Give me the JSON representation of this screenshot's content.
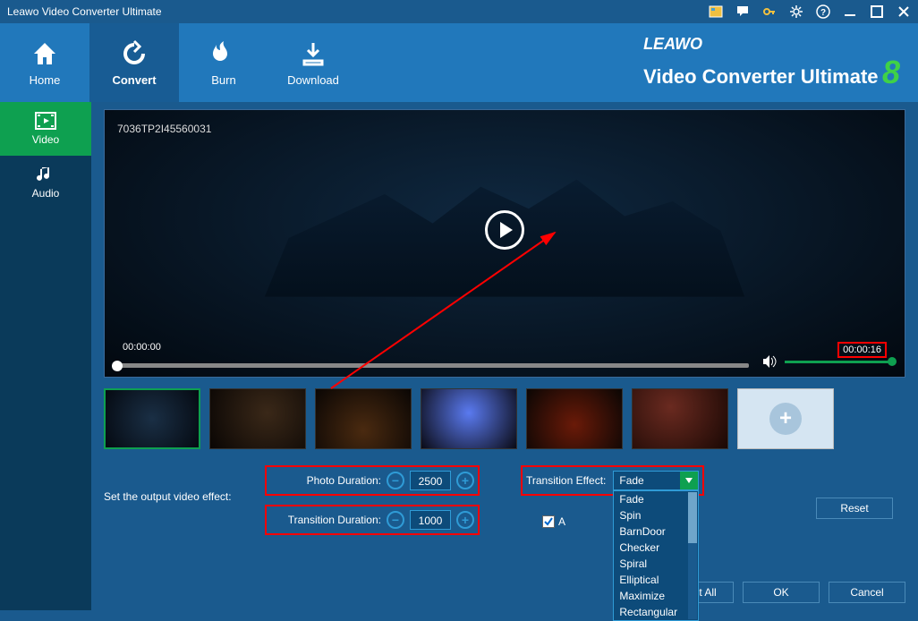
{
  "titlebar": {
    "title": "Leawo Video Converter Ultimate"
  },
  "nav": {
    "home": "Home",
    "convert": "Convert",
    "burn": "Burn",
    "download": "Download"
  },
  "brand": {
    "leawo": "LEAWO",
    "main": "Video Converter Ultimate",
    "version": "8"
  },
  "sidebar": {
    "video": "Video",
    "audio": "Audio"
  },
  "preview": {
    "id": "7036TP2I45560031",
    "time_start": "00:00:00",
    "time_end": "00:00:16"
  },
  "settings": {
    "label": "Set the output video effect:",
    "photo_duration_label": "Photo Duration:",
    "photo_duration_value": "2500",
    "transition_duration_label": "Transition Duration:",
    "transition_duration_value": "1000",
    "transition_effect_label": "Transition Effect:",
    "apply_all": "A",
    "dropdown": {
      "selected": "Fade",
      "options": [
        "Fade",
        "Spin",
        "BarnDoor",
        "Checker",
        "Spiral",
        "Elliptical",
        "Maximize",
        "Rectangular"
      ]
    }
  },
  "buttons": {
    "reset": "Reset",
    "reset_all": "Reset All",
    "ok": "OK",
    "cancel": "Cancel"
  }
}
